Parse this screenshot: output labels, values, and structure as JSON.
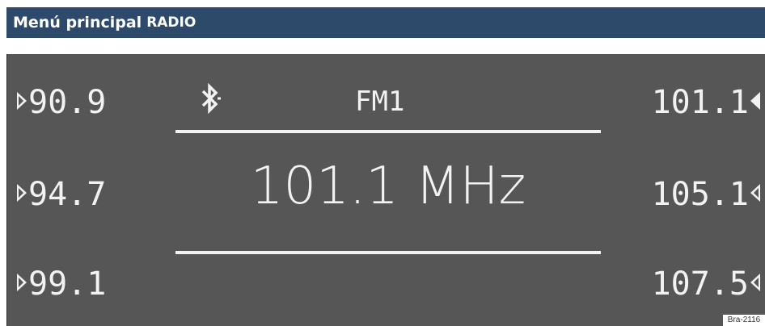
{
  "header": {
    "title": "Menú principal",
    "mode": "RADIO"
  },
  "display": {
    "band": "FM1",
    "current_frequency": "101.1 MHz",
    "bluetooth_icon": "bluetooth-icon",
    "left_presets": [
      {
        "label": "90.9",
        "icon": "play-right-icon"
      },
      {
        "label": "94.7",
        "icon": "play-right-icon"
      },
      {
        "label": "99.1",
        "icon": "play-right-icon"
      }
    ],
    "right_presets": [
      {
        "label": "101.1",
        "icon": "play-left-filled-icon"
      },
      {
        "label": "105.1",
        "icon": "play-left-outline-icon"
      },
      {
        "label": "107.5",
        "icon": "play-left-outline-icon"
      }
    ]
  },
  "reference_code": "Bra-2116",
  "colors": {
    "header_bg": "#2e4a6b",
    "screen_bg": "#565656",
    "text": "#f2f2f2"
  }
}
